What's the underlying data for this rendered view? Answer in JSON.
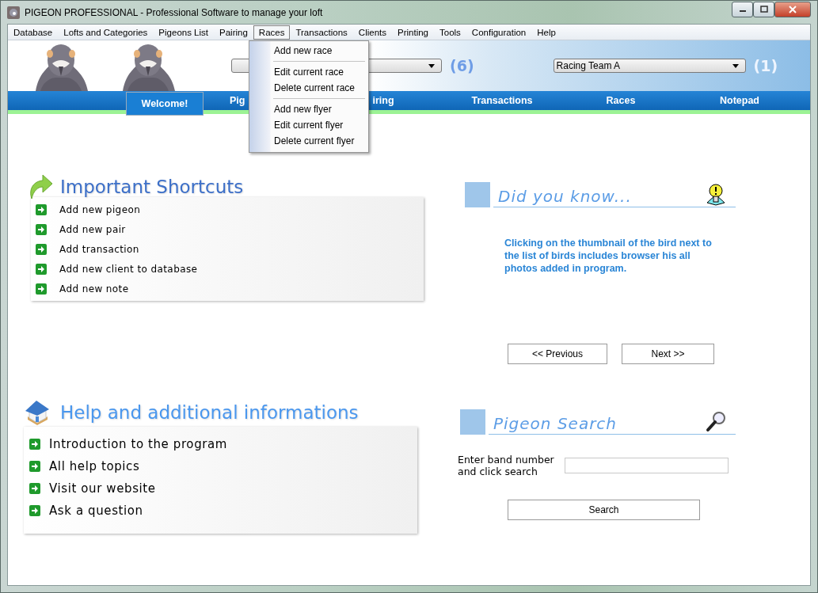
{
  "window": {
    "title": "PIGEON PROFESSIONAL - Professional Software to manage your loft"
  },
  "menu_bar": [
    {
      "label": "Database",
      "selected": false
    },
    {
      "label": "Lofts and Categories",
      "selected": false
    },
    {
      "label": "Pigeons List",
      "selected": false
    },
    {
      "label": "Pairing",
      "selected": false
    },
    {
      "label": "Races",
      "selected": true
    },
    {
      "label": "Transactions",
      "selected": false
    },
    {
      "label": "Clients",
      "selected": false
    },
    {
      "label": "Printing",
      "selected": false
    },
    {
      "label": "Tools",
      "selected": false
    },
    {
      "label": "Configuration",
      "selected": false
    },
    {
      "label": "Help",
      "selected": false
    }
  ],
  "open_menu": {
    "groups": [
      [
        "Add new race"
      ],
      [
        "Edit current race",
        "Delete current race"
      ],
      [
        "Add new flyer",
        "Edit current flyer",
        "Delete current flyer"
      ]
    ]
  },
  "header": {
    "selectors": [
      {
        "count": "(6)"
      },
      {
        "value": "Racing Team A",
        "count": "(1)"
      }
    ]
  },
  "nav_tabs": [
    {
      "label": "Welcome!",
      "selected": true
    },
    {
      "label": "Pig",
      "selected": false
    },
    {
      "label": "iring",
      "selected": false
    },
    {
      "label": "Transactions",
      "selected": false
    },
    {
      "label": "Races",
      "selected": false
    },
    {
      "label": "Notepad",
      "selected": false
    }
  ],
  "shortcuts": {
    "title": "Important Shortcuts",
    "items": [
      "Add new pigeon",
      "Add new pair",
      "Add transaction",
      "Add new client to database",
      "Add new note"
    ]
  },
  "did_you_know": {
    "title": "Did you know...",
    "text": "Clicking on the thumbnail of the bird next to the list of birds includes browser his all photos added in program.",
    "buttons": [
      "<< Previous",
      "Next >>"
    ]
  },
  "help": {
    "title": "Help and additional informations",
    "items": [
      "Introduction to the program",
      "All help topics",
      "Visit our website",
      "Ask a question"
    ]
  },
  "pigeon_search": {
    "title": "Pigeon Search",
    "label": "Enter band number and click search",
    "button": "Search"
  }
}
